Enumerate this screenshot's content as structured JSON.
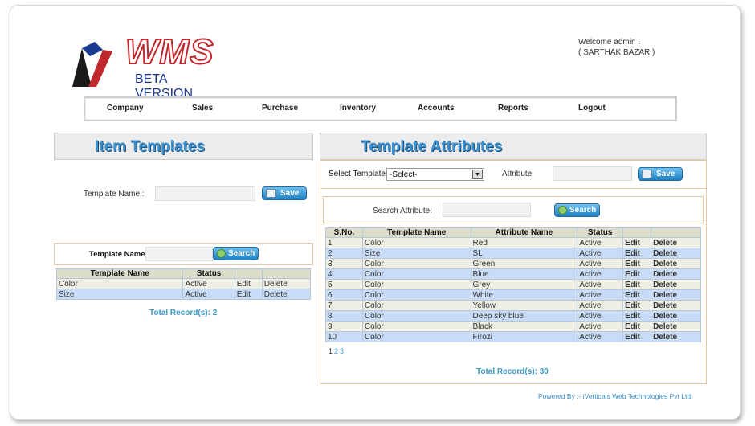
{
  "header": {
    "logo_text": "WMS",
    "logo_sub": "BETA VERSION",
    "welcome_line1": "Welcome admin !",
    "welcome_line2": "( SARTHAK BAZAR )"
  },
  "nav": [
    "Company",
    "Sales",
    "Purchase",
    "Inventory",
    "Accounts",
    "Reports",
    "Logout"
  ],
  "left": {
    "title": "Item Templates",
    "template_name_label": "Template Name :",
    "save_label": "Save",
    "search_label": "Template Name",
    "search_button": "Search",
    "columns": [
      "Template Name",
      "Status",
      "",
      ""
    ],
    "rows": [
      {
        "name": "Color",
        "status": "Active",
        "edit": "Edit",
        "delete": "Delete"
      },
      {
        "name": "Size",
        "status": "Active",
        "edit": "Edit",
        "delete": "Delete"
      }
    ],
    "total": "Total Record(s):  2"
  },
  "right": {
    "title": "Template Attributes",
    "select_label": "Select Template",
    "select_value": "-Select-",
    "attribute_label": "Attribute:",
    "save_label": "Save",
    "search_label": "Search Attribute:",
    "search_button": "Search",
    "columns": [
      "S.No.",
      "Template Name",
      "Attribute Name",
      "Status",
      "",
      ""
    ],
    "rows": [
      {
        "sno": "1",
        "tpl": "Color",
        "attr": "Red",
        "status": "Active",
        "edit": "Edit",
        "delete": "Delete"
      },
      {
        "sno": "2",
        "tpl": "Size",
        "attr": "SL",
        "status": "Active",
        "edit": "Edit",
        "delete": "Delete"
      },
      {
        "sno": "3",
        "tpl": "Color",
        "attr": "Green",
        "status": "Active",
        "edit": "Edit",
        "delete": "Delete"
      },
      {
        "sno": "4",
        "tpl": "Color",
        "attr": "Blue",
        "status": "Active",
        "edit": "Edit",
        "delete": "Delete"
      },
      {
        "sno": "5",
        "tpl": "Color",
        "attr": "Grey",
        "status": "Active",
        "edit": "Edit",
        "delete": "Delete"
      },
      {
        "sno": "6",
        "tpl": "Color",
        "attr": "White",
        "status": "Active",
        "edit": "Edit",
        "delete": "Delete"
      },
      {
        "sno": "7",
        "tpl": "Color",
        "attr": "Yellow",
        "status": "Active",
        "edit": "Edit",
        "delete": "Delete"
      },
      {
        "sno": "8",
        "tpl": "Color",
        "attr": "Deep sky blue",
        "status": "Active",
        "edit": "Edit",
        "delete": "Delete"
      },
      {
        "sno": "9",
        "tpl": "Color",
        "attr": "Black",
        "status": "Active",
        "edit": "Edit",
        "delete": "Delete"
      },
      {
        "sno": "10",
        "tpl": "Color",
        "attr": "Firozi",
        "status": "Active",
        "edit": "Edit",
        "delete": "Delete"
      }
    ],
    "pages": [
      "1",
      "2",
      "3"
    ],
    "total": "Total Record(s):  30"
  },
  "footer": "Powered By :- iVerticals Web Technologies Pvt Ltd",
  "colors": {
    "accent": "#3a8fcc",
    "row_alt": "#c8dcf8",
    "row": "#eeeee4",
    "brand": "#c0282d"
  }
}
